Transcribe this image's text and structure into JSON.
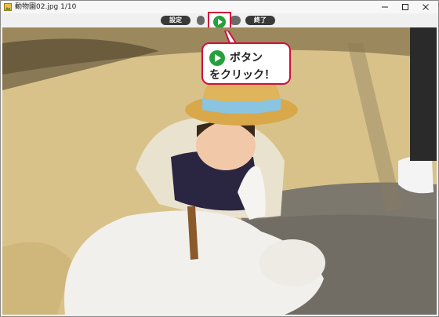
{
  "window": {
    "title": "動物園02.jpg 1/10"
  },
  "toolbar": {
    "settings_label": "設定",
    "exit_label": "終了"
  },
  "callout": {
    "line1": "ボタン",
    "line2": "をクリック！"
  },
  "colors": {
    "accent_red": "#d0103a",
    "play_green": "#27a03c",
    "pill_dark": "#3a3a3a"
  },
  "photo": {
    "subject": ""
  }
}
